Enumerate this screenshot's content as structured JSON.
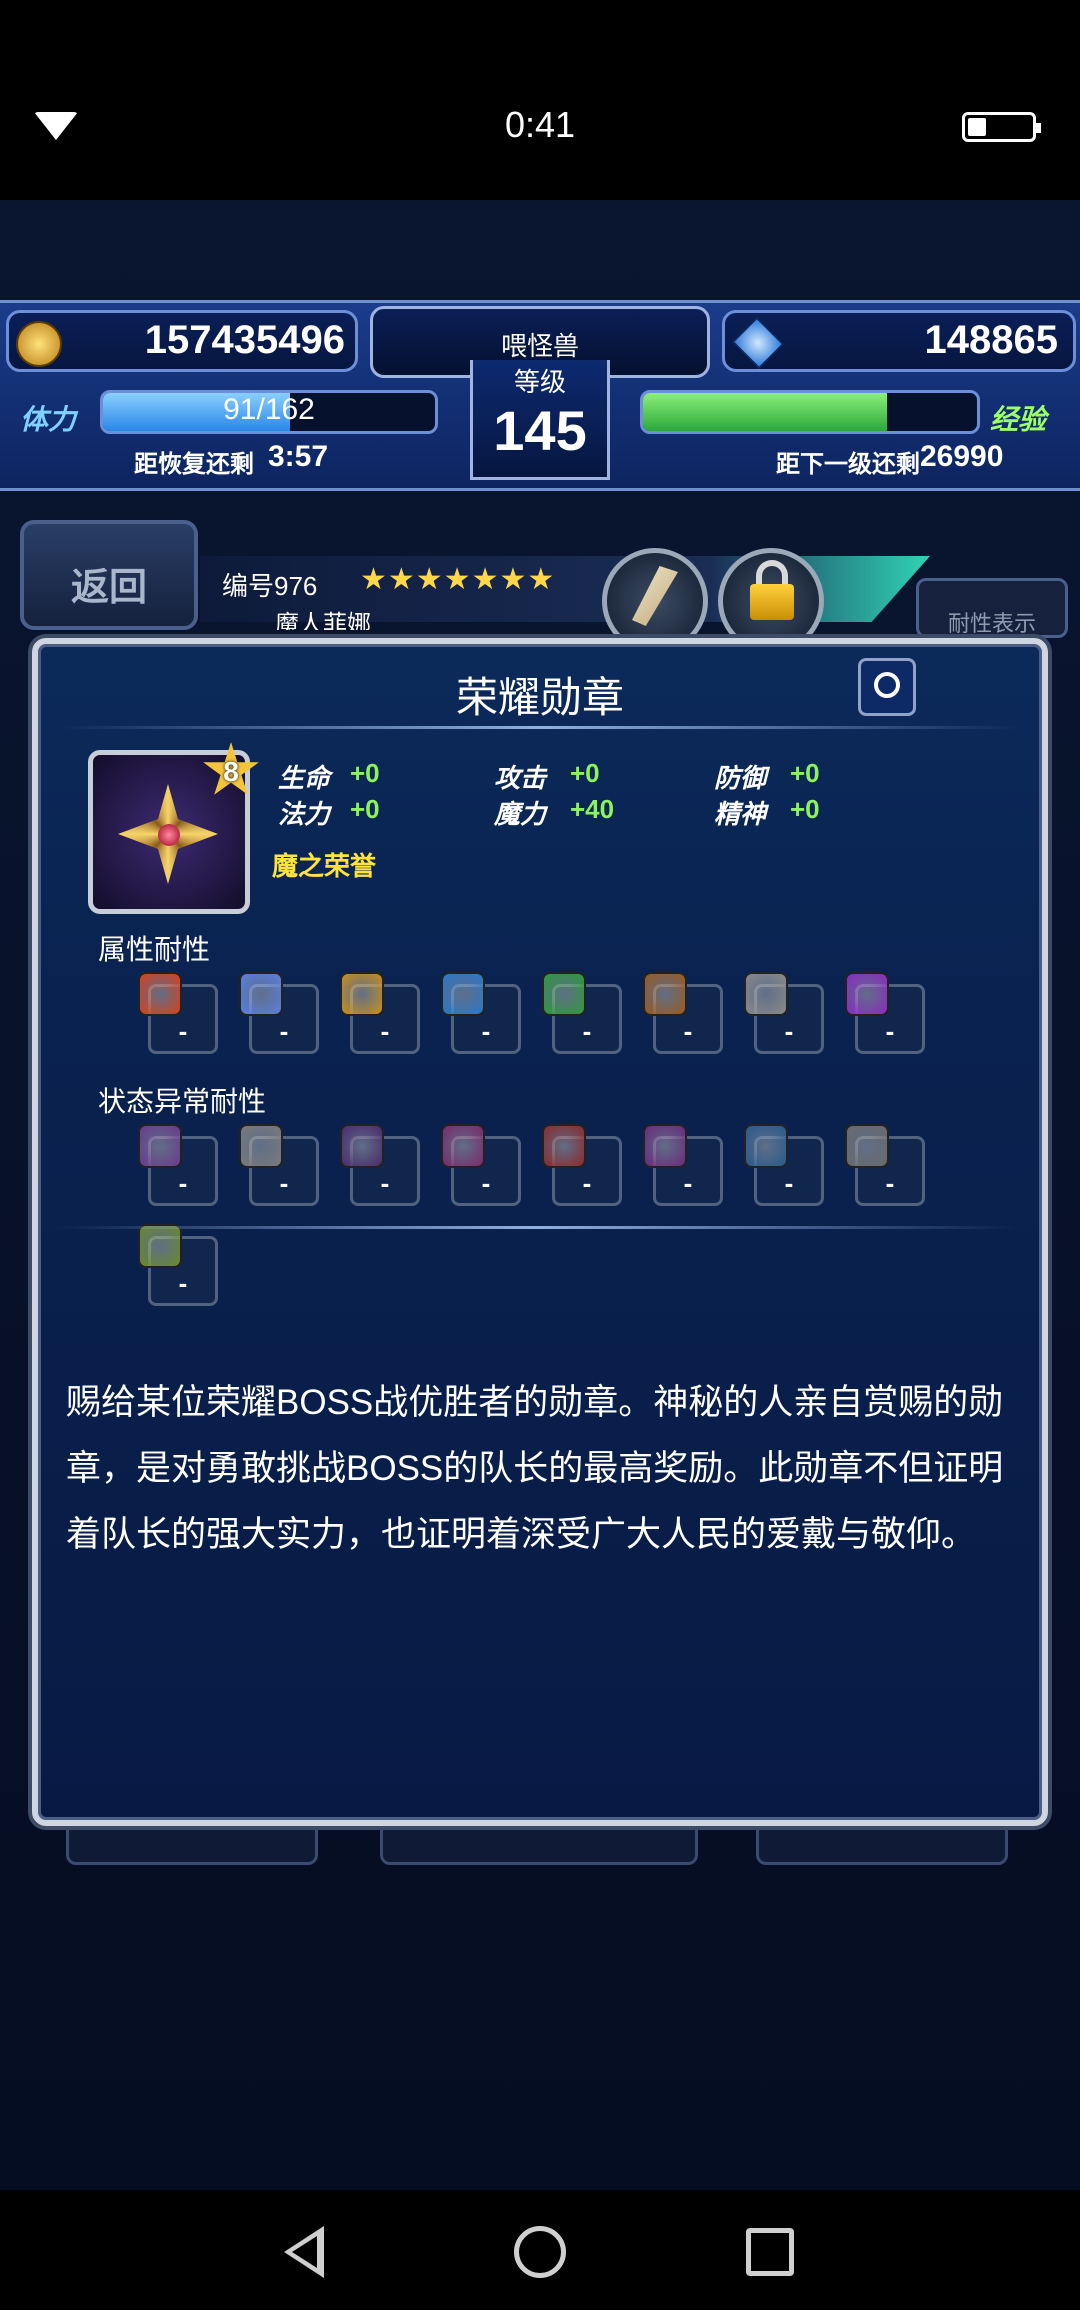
{
  "status_bar": {
    "time": "0:41"
  },
  "hud": {
    "gil": "157435496",
    "gems": "148865",
    "player_name": "喂怪兽",
    "level_label": "等级",
    "level": "145",
    "stamina_label": "体力",
    "stamina_text": "91/162",
    "stamina_fraction": 0.562,
    "stamina_recover_label": "距恢复还剩",
    "stamina_recover_time": "3:57",
    "exp_label": "经验",
    "exp_fraction": 0.73,
    "exp_next_label": "距下一级还剩",
    "exp_next_value": "26990"
  },
  "unit_bar": {
    "back_label": "返回",
    "unit_number": "编号976",
    "stars": "★★★★★★★",
    "unit_name": "魔人菲娜",
    "hide_label": "耐性表示"
  },
  "item": {
    "title": "荣耀勋章",
    "rank": "8",
    "name": "魔之荣誉",
    "stats": [
      {
        "label": "生命",
        "value": "+0"
      },
      {
        "label": "法力",
        "value": "+0"
      },
      {
        "label": "攻击",
        "value": "+0"
      },
      {
        "label": "魔力",
        "value": "+40"
      },
      {
        "label": "防御",
        "value": "+0"
      },
      {
        "label": "精神",
        "value": "+0"
      }
    ],
    "element_title": "属性耐性",
    "elements": [
      {
        "icon": "fire-icon",
        "value": "-",
        "color": "#d8401c"
      },
      {
        "icon": "ice-icon",
        "value": "-",
        "color": "#5a7fe0"
      },
      {
        "icon": "lightning-icon",
        "value": "-",
        "color": "#c9901c"
      },
      {
        "icon": "water-icon",
        "value": "-",
        "color": "#2a78c8"
      },
      {
        "icon": "wind-icon",
        "value": "-",
        "color": "#2e9a3a"
      },
      {
        "icon": "earth-icon",
        "value": "-",
        "color": "#9a5a1e"
      },
      {
        "icon": "light-icon",
        "value": "-",
        "color": "#8a8a8a"
      },
      {
        "icon": "dark-icon",
        "value": "-",
        "color": "#8a2ac0"
      }
    ],
    "status_title": "状态异常耐性",
    "statuses": [
      {
        "icon": "poison-icon",
        "value": "-",
        "color": "#6b3a8a"
      },
      {
        "icon": "blind-icon",
        "value": "-",
        "color": "#7a7a7a"
      },
      {
        "icon": "sleep-icon",
        "value": "-",
        "color": "#4a2a6a"
      },
      {
        "icon": "silence-icon",
        "value": "-",
        "color": "#7a2a6a"
      },
      {
        "icon": "paralyze-icon",
        "value": "-",
        "color": "#8a2a2a"
      },
      {
        "icon": "confuse-icon",
        "value": "-",
        "color": "#6a2a7a"
      },
      {
        "icon": "disease-icon",
        "value": "-",
        "color": "#2a5a8a"
      },
      {
        "icon": "petrify-icon",
        "value": "-",
        "color": "#6a6a6a"
      },
      {
        "icon": "death-icon",
        "value": "-",
        "color": "#6a8a2a"
      }
    ],
    "description": "赐给某位荣耀BOSS战优胜者的勋章。神秘的人亲自赏赐的勋章，是对勇敢挑战BOSS的队长的最高奖励。此勋章不但证明着队长的强大实力，也证明着深受广大人民的爱戴与敬仰。"
  }
}
